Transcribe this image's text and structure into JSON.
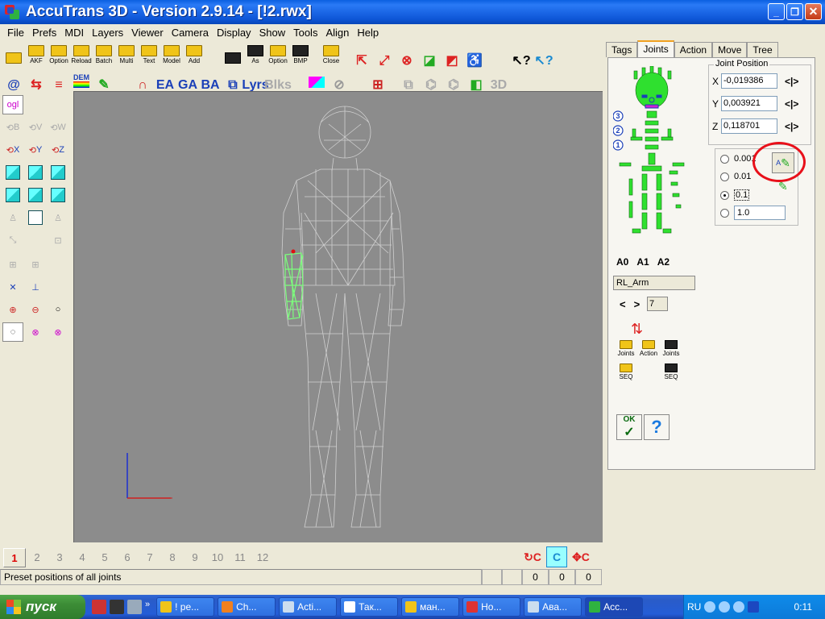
{
  "window": {
    "title": "AccuTrans 3D - Version 2.9.14 - [!2.rwx]"
  },
  "menu": [
    "File",
    "Prefs",
    "MDI",
    "Layers",
    "Viewer",
    "Camera",
    "Display",
    "Show",
    "Tools",
    "Align",
    "Help"
  ],
  "toolbar": {
    "row1_labels": [
      "AKF",
      "Option",
      "Reload",
      "Batch",
      "Multi",
      "Text",
      "Model",
      "Add",
      "",
      "As",
      "Option",
      "BMP",
      "Close"
    ],
    "row2_labels": [
      "@",
      "DEM",
      "EA",
      "GA",
      "BA",
      "Lyrs",
      "Blks",
      "3D"
    ]
  },
  "left_tools": {
    "ogl_label": "ogl",
    "rot_labels": [
      "B",
      "V",
      "W"
    ],
    "axis_labels": [
      "X",
      "Y",
      "Z"
    ]
  },
  "pages": {
    "numbers": [
      "1",
      "2",
      "3",
      "4",
      "5",
      "6",
      "7",
      "8",
      "9",
      "10",
      "11",
      "12"
    ],
    "active": "1"
  },
  "rot_buttons": [
    "C",
    "C",
    "C"
  ],
  "status": {
    "text": "Preset positions of all joints",
    "values": [
      "0",
      "0",
      "0"
    ]
  },
  "tabs": [
    "Tags",
    "Joints",
    "Action",
    "Move",
    "Tree"
  ],
  "active_tab": "Joints",
  "joints": {
    "presets": [
      "A0",
      "A1",
      "A2"
    ],
    "level_markers": [
      "3",
      "2",
      "1"
    ],
    "joint_name": "RL_Arm",
    "joint_index": "7",
    "nav_prev": "<",
    "nav_next": ">",
    "button_labels": [
      "Joints",
      "Action",
      "Joints",
      "SEQ",
      "SEQ"
    ],
    "ok_label": "OK",
    "help_label": "?"
  },
  "joint_position": {
    "title": "Joint Position",
    "x_label": "X",
    "x": "-0,019386",
    "y_label": "Y",
    "y": "0,003921",
    "z_label": "Z",
    "z": "0,118701",
    "step_symbol": "<|>"
  },
  "precision": {
    "options": [
      "0.001",
      "0.01",
      "0.1"
    ],
    "selected": "0.1",
    "custom_value": "1.0",
    "tool_label": "A"
  },
  "taskbar": {
    "start_label": "пуск",
    "tasks": [
      "! pe...",
      "Ch...",
      "Acti...",
      "Так...",
      "ман...",
      "Но...",
      "Ава...",
      "Acc..."
    ],
    "language": "RU",
    "clock": "0:11"
  },
  "colors": {
    "titlebar": "#0a5fe0",
    "viewport": "#8c8c8c",
    "highlight_circle": "#e8101a",
    "skeleton": "#2fe02f",
    "mesh": "#d0d0d0",
    "selected_mesh": "#7cff7c"
  }
}
